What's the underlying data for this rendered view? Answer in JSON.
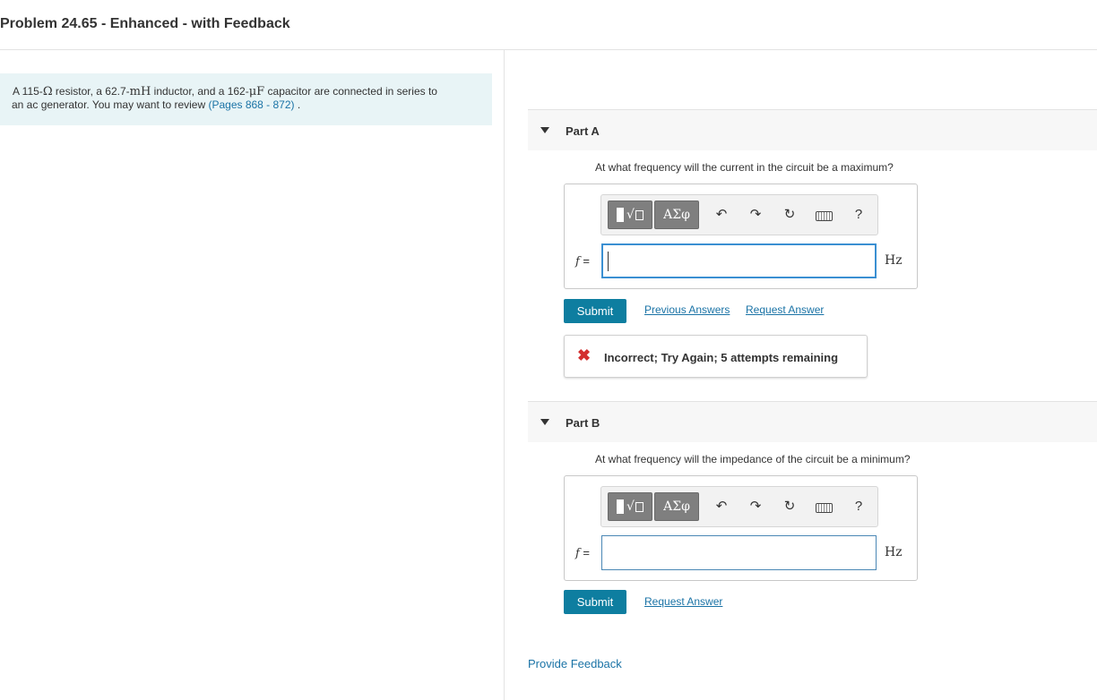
{
  "page": {
    "title": "Problem 24.65 - Enhanced - with Feedback"
  },
  "problem": {
    "t1": "A 115-",
    "ohm": "Ω",
    "t2": " resistor, a 62.7-",
    "mH": "mH",
    "t3": " inductor, and a 162-",
    "uF": "μF",
    "t4": " capacitor are connected in series to",
    "t5": "an ac generator. You may want to review ",
    "pages_link": "(Pages 868 - 872)",
    "t6": " ."
  },
  "toolbar": {
    "greek_label": "ΑΣφ",
    "undo_icon": "↶",
    "redo_icon": "↷",
    "reset_icon": "↻",
    "help_label": "?"
  },
  "partA": {
    "label": "Part A",
    "question": "At what frequency will the current in the circuit be a maximum?",
    "var_label": "f",
    "eq": " =",
    "value": "",
    "unit": "Hz",
    "submit": "Submit",
    "prev_answers": "Previous Answers",
    "request_answer": "Request Answer",
    "feedback_icon": "✖",
    "feedback": "Incorrect; Try Again; 5 attempts remaining"
  },
  "partB": {
    "label": "Part B",
    "question": "At what frequency will the impedance of the circuit be a minimum?",
    "var_label": "f",
    "eq": " =",
    "value": "",
    "unit": "Hz",
    "submit": "Submit",
    "request_answer": "Request Answer"
  },
  "footer": {
    "provide_feedback": "Provide Feedback"
  }
}
